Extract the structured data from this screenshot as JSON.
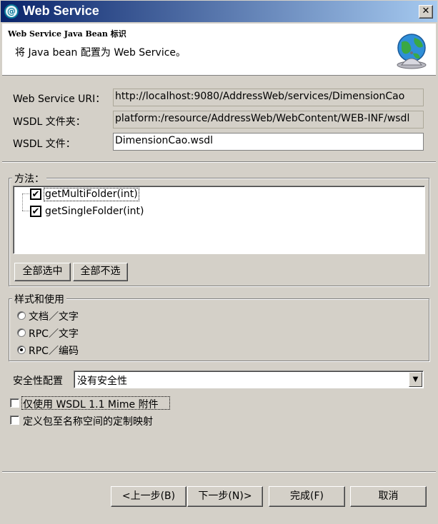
{
  "window": {
    "title": "Web Service",
    "close_glyph": "✕",
    "app_icon": "eclipse-wsdl-icon"
  },
  "banner": {
    "title": "Web Service Java Bean 标识",
    "description": "将 Java bean 配置为 Web Service。",
    "icon": "globe-service-bell-icon"
  },
  "form": {
    "uri_label": "Web Service URI：",
    "uri_value": "http://localhost:9080/AddressWeb/services/DimensionCao",
    "folder_label": "WSDL 文件夹：",
    "folder_value": "platform:/resource/AddressWeb/WebContent/WEB-INF/wsdl",
    "file_label": "WSDL 文件：",
    "file_value": "DimensionCao.wsdl"
  },
  "methods": {
    "group_title": "方法：",
    "items": [
      {
        "label": "getMultiFolder(int)",
        "checked": true
      },
      {
        "label": "getSingleFolder(int)",
        "checked": true
      }
    ],
    "select_all": "全部选中",
    "deselect_all": "全部不选"
  },
  "style": {
    "group_title": "样式和使用",
    "options": [
      {
        "label": "文档／文字",
        "selected": false
      },
      {
        "label": "RPC／文字",
        "selected": false
      },
      {
        "label": "RPC／编码",
        "selected": true
      }
    ]
  },
  "security": {
    "label": "安全性配置",
    "value": "没有安全性"
  },
  "options": {
    "mime_only": "仅使用 WSDL 1.1 Mime 附件",
    "custom_mapping": "定义包至名称空间的定制映射"
  },
  "buttons": {
    "back": "<上一步(B)",
    "next": "下一步(N)>",
    "finish": "完成(F)",
    "cancel": "取消"
  }
}
